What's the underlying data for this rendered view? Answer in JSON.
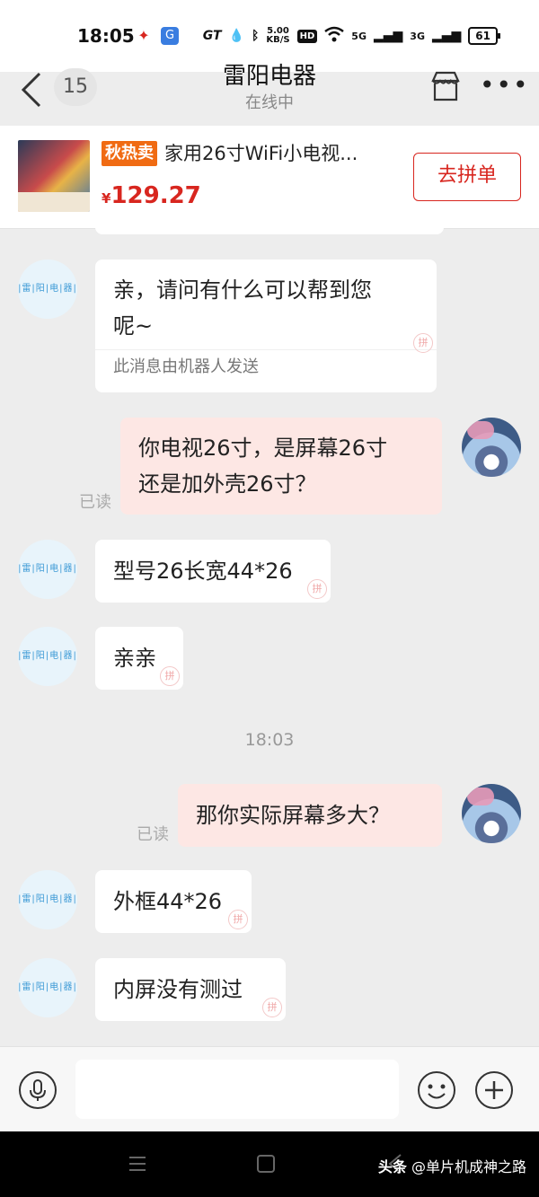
{
  "status_bar": {
    "time": "18:05",
    "app_icons": [
      "pinduoduo-icon",
      "browser-icon"
    ],
    "net_speed_value": "5.00",
    "net_speed_unit": "KB/S",
    "brand": "GT",
    "hd_label": "HD",
    "signal1": "5G",
    "signal2": "3G",
    "battery": "61"
  },
  "header": {
    "unread_count": "15",
    "title": "雷阳电器",
    "status": "在线中"
  },
  "product": {
    "tag": "秋热卖",
    "name": "家用26寸WiFi小电视...",
    "price_symbol": "¥",
    "price": "129.27",
    "button": "去拼单"
  },
  "shop_avatar_text": "|雷|阳|电|器|",
  "messages": [
    {
      "from": "shop",
      "text_line1": "亲，请问有什么可以帮到您",
      "text_line2": "呢~",
      "footnote": "此消息由机器人发送"
    },
    {
      "from": "user",
      "text_line1": "你电视26寸，是屏幕26寸",
      "text_line2": "还是加外壳26寸？",
      "receipt": "已读"
    },
    {
      "from": "shop",
      "text": "型号26长宽44*26"
    },
    {
      "from": "shop",
      "text": "亲亲"
    },
    {
      "from": "user",
      "text": "那你实际屏幕多大？",
      "receipt": "已读"
    },
    {
      "from": "shop",
      "text": "外框44*26"
    },
    {
      "from": "shop",
      "text": "内屏没有测过"
    }
  ],
  "time_divider": "18:03",
  "pin_mark_text": "拼",
  "input": {
    "placeholder": ""
  },
  "watermark": {
    "prefix": "头条",
    "handle": "@单片机成神之路"
  }
}
